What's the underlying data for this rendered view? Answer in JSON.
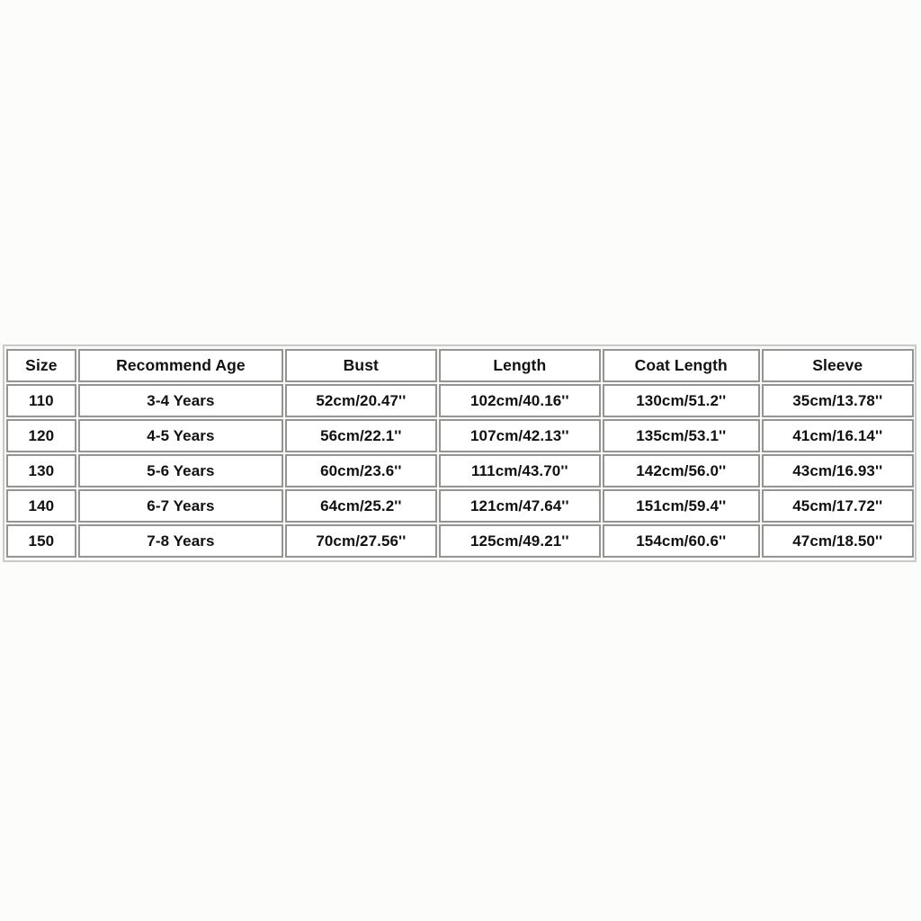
{
  "table": {
    "name": "size-chart",
    "columns": [
      "Size",
      "Recommend Age",
      "Bust",
      "Length",
      "Coat Length",
      "Sleeve"
    ],
    "rows": [
      [
        "110",
        "3-4 Years",
        "52cm/20.47''",
        "102cm/40.16''",
        "130cm/51.2''",
        "35cm/13.78''"
      ],
      [
        "120",
        "4-5 Years",
        "56cm/22.1''",
        "107cm/42.13''",
        "135cm/53.1''",
        "41cm/16.14''"
      ],
      [
        "130",
        "5-6 Years",
        "60cm/23.6''",
        "111cm/43.70''",
        "142cm/56.0''",
        "43cm/16.93''"
      ],
      [
        "140",
        "6-7 Years",
        "64cm/25.2''",
        "121cm/47.64''",
        "151cm/59.4''",
        "45cm/17.72''"
      ],
      [
        "150",
        "7-8 Years",
        "70cm/27.56''",
        "125cm/49.21''",
        "154cm/60.6''",
        "47cm/18.50''"
      ]
    ]
  },
  "colors": {
    "page_background": "#fcfcfb",
    "cell_background": "#ffffff",
    "cell_border": "#949492",
    "outer_border": "#c9c9c7",
    "text": "#111111"
  }
}
